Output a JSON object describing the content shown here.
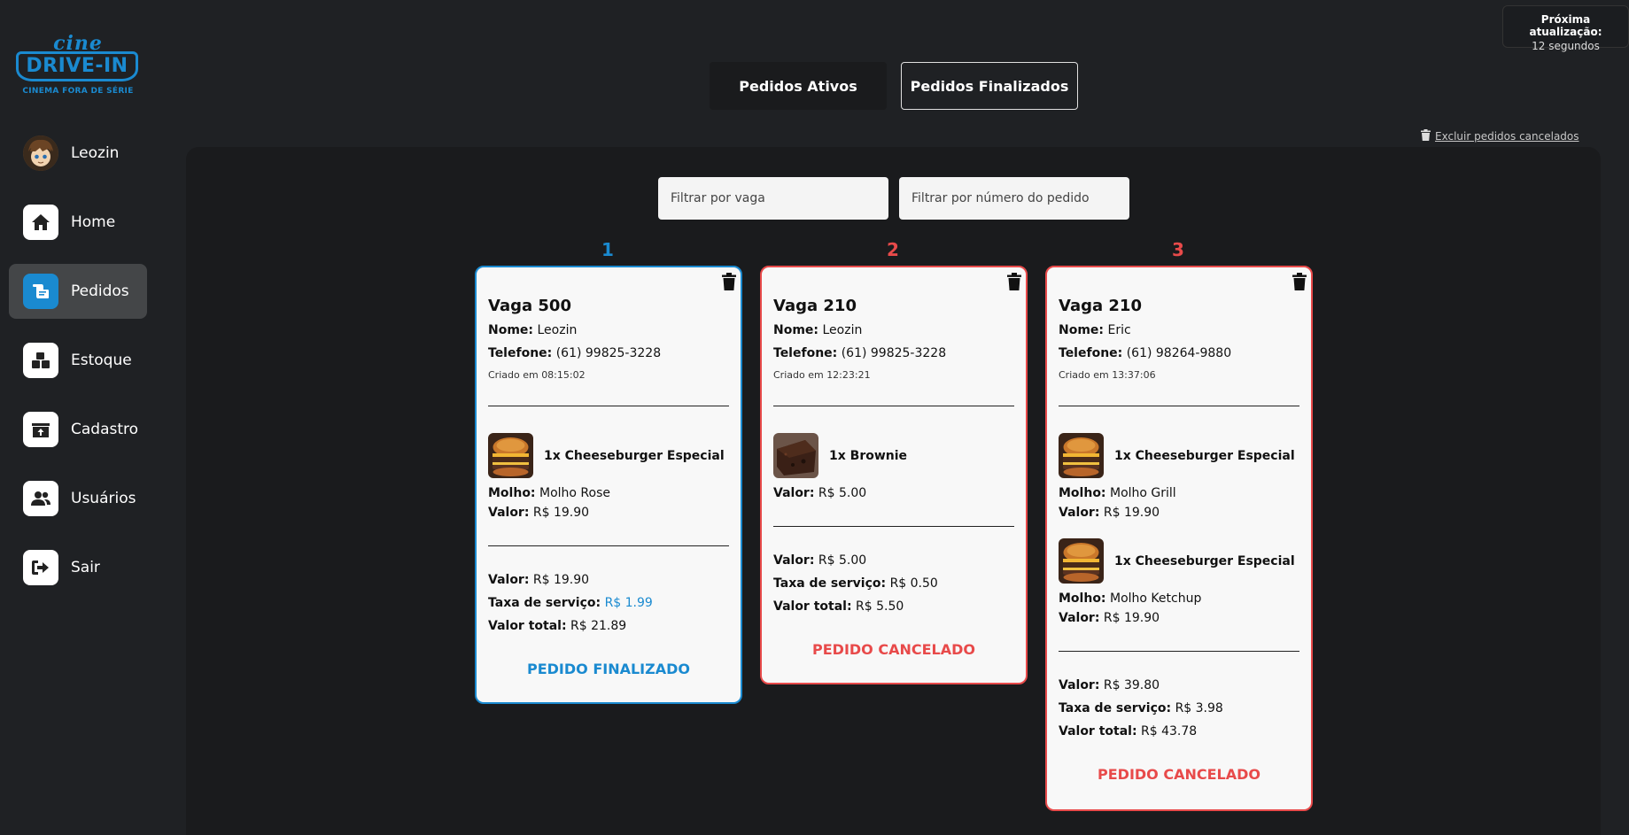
{
  "logo": {
    "line1": "cine",
    "line2": "DRIVE-IN",
    "tagline": "CINEMA FORA DE SÉRIE"
  },
  "user": {
    "name": "Leozin"
  },
  "nav": [
    {
      "label": "Home",
      "icon": "home-icon"
    },
    {
      "label": "Pedidos",
      "icon": "orders-icon",
      "active": true
    },
    {
      "label": "Estoque",
      "icon": "boxes-icon"
    },
    {
      "label": "Cadastro",
      "icon": "register-icon"
    },
    {
      "label": "Usuários",
      "icon": "users-icon"
    },
    {
      "label": "Sair",
      "icon": "logout-icon"
    }
  ],
  "update": {
    "label": "Próxima atualização:",
    "value": "12 segundos"
  },
  "tabs": {
    "active": "Pedidos Ativos",
    "finished": "Pedidos Finalizados"
  },
  "clear_canceled": "Excluir pedidos cancelados",
  "filters": {
    "vaga_placeholder": "Filtrar por vaga",
    "numero_placeholder": "Filtrar por número do pedido"
  },
  "labels": {
    "nome": "Nome:",
    "telefone": "Telefone:",
    "molho": "Molho:",
    "valor": "Valor:",
    "taxa": "Taxa de serviço:",
    "total": "Valor total:"
  },
  "colors": {
    "accent": "#1a8ad0",
    "canceled": "#e84a4a",
    "background": "#1f2124"
  },
  "orders": [
    {
      "number": "1",
      "vaga": "Vaga 500",
      "nome": "Leozin",
      "telefone": "(61) 99825-3228",
      "criado": "Criado em 08:15:02",
      "items": [
        {
          "name": "1x Cheeseburger Especial",
          "molho": "Molho Rose",
          "valor": "R$ 19.90",
          "image": "burger"
        }
      ],
      "valor": "R$ 19.90",
      "taxa": "R$ 1.99",
      "total": "R$ 21.89",
      "status": "PEDIDO FINALIZADO"
    },
    {
      "number": "2",
      "vaga": "Vaga 210",
      "nome": "Leozin",
      "telefone": "(61) 99825-3228",
      "criado": "Criado em 12:23:21",
      "items": [
        {
          "name": "1x Brownie",
          "valor": "R$ 5.00",
          "image": "brownie"
        }
      ],
      "valor": "R$ 5.00",
      "taxa": "R$ 0.50",
      "total": "R$ 5.50",
      "status": "PEDIDO CANCELADO"
    },
    {
      "number": "3",
      "vaga": "Vaga 210",
      "nome": "Eric",
      "telefone": "(61) 98264-9880",
      "criado": "Criado em 13:37:06",
      "items": [
        {
          "name": "1x Cheeseburger Especial",
          "molho": "Molho Grill",
          "valor": "R$ 19.90",
          "image": "burger"
        },
        {
          "name": "1x Cheeseburger Especial",
          "molho": "Molho Ketchup",
          "valor": "R$ 19.90",
          "image": "burger"
        }
      ],
      "valor": "R$ 39.80",
      "taxa": "R$ 3.98",
      "total": "R$ 43.78",
      "status": "PEDIDO CANCELADO"
    }
  ]
}
